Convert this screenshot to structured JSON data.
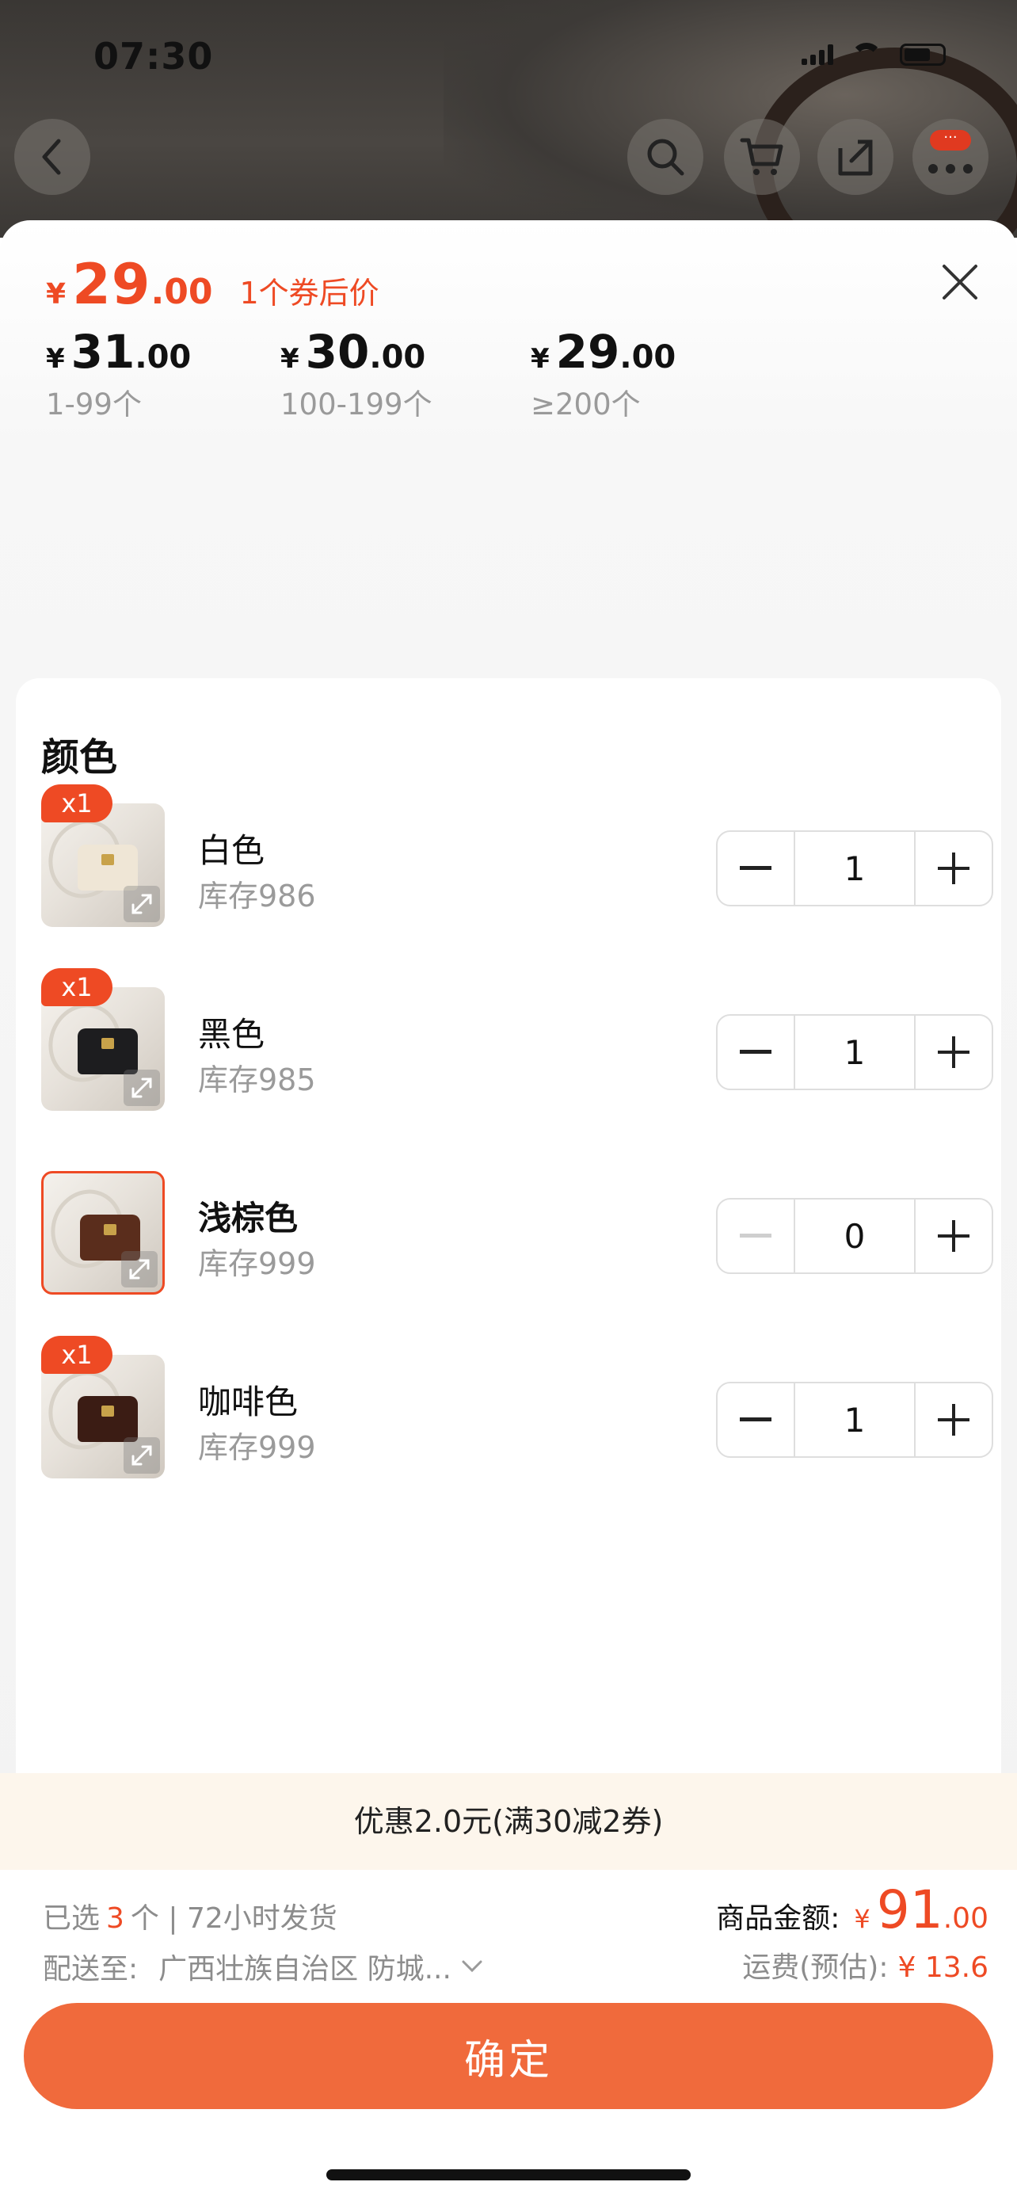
{
  "status_bar": {
    "time": "07:30"
  },
  "header_icons": [
    "back-icon",
    "search-icon",
    "cart-icon",
    "share-icon",
    "more-icon"
  ],
  "more_badge": "···",
  "price": {
    "yen": "¥",
    "int": "29",
    "dec": ".00",
    "coupon_label": "1个券后价"
  },
  "tiers": [
    {
      "yen": "¥",
      "int": "31",
      "dec": ".00",
      "range": "1-99个"
    },
    {
      "yen": "¥",
      "int": "30",
      "dec": ".00",
      "range": "100-199个"
    },
    {
      "yen": "¥",
      "int": "29",
      "dec": ".00",
      "range": "≥200个"
    }
  ],
  "section_title": "颜色",
  "variants": [
    {
      "badge": "x1",
      "name": "白色",
      "stock": "库存986",
      "qty": "1",
      "selected": false,
      "bag_color": "#efe6d6"
    },
    {
      "badge": "x1",
      "name": "黑色",
      "stock": "库存985",
      "qty": "1",
      "selected": false,
      "bag_color": "#1d1d1f"
    },
    {
      "badge": "",
      "name": "浅棕色",
      "stock": "库存999",
      "qty": "0",
      "selected": true,
      "bag_color": "#5a2d1c"
    },
    {
      "badge": "x1",
      "name": "咖啡色",
      "stock": "库存999",
      "qty": "1",
      "selected": false,
      "bag_color": "#3b1c14"
    }
  ],
  "promo": "优惠2.0元(满30减2券)",
  "summary": {
    "selected_prefix": "已选",
    "selected_count": "3",
    "selected_suffix": "个 | 72小时发货",
    "ship_label": "配送至:",
    "ship_address": "广西壮族自治区 防城...",
    "amount_label": "商品金额:",
    "amount_yen": "¥",
    "amount_int": "91",
    "amount_dec": ".00",
    "freight_label": "运费(预估):",
    "freight_value": "¥ 13.6"
  },
  "confirm_label": "确定",
  "colors": {
    "accent": "#ee4a24",
    "button": "#f06a3c",
    "promo_bg": "#fdf6ec"
  }
}
